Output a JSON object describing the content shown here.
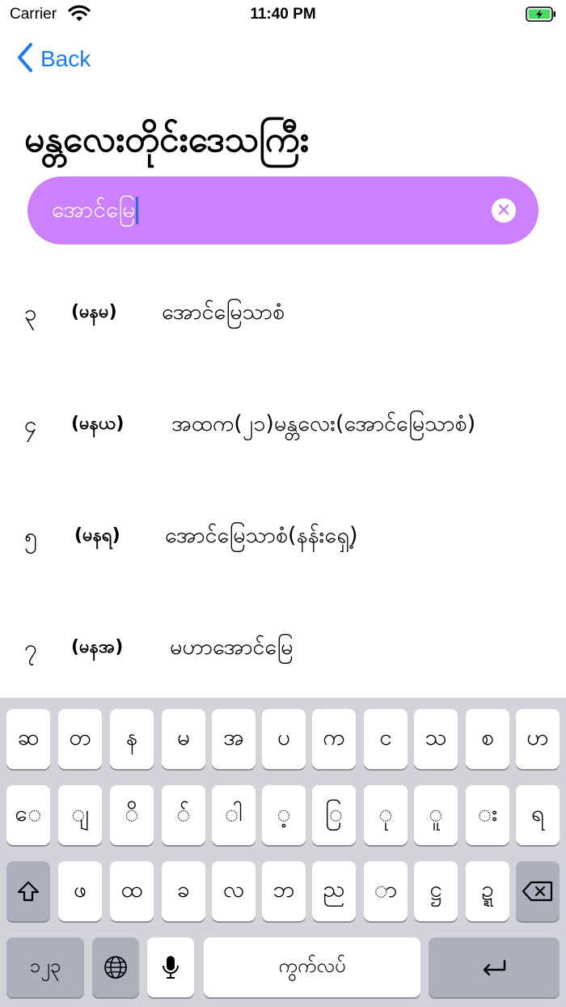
{
  "status_bar": {
    "carrier": "Carrier",
    "time": "11:40 PM",
    "wifi_icon": "wifi-icon",
    "battery_icon": "battery-charging-icon"
  },
  "nav": {
    "back_label": "Back",
    "back_icon": "chevron-left-icon",
    "accent": "#1a7cf7"
  },
  "page": {
    "title": "မန္တလေးတိုင်းဒေသကြီး"
  },
  "search": {
    "value": "အောင်မြေ",
    "clear_icon": "clear-icon",
    "background": "#cc80fb"
  },
  "results": [
    {
      "number": "၃",
      "code": "(မနမ)",
      "name": "အောင်မြေသာစံ"
    },
    {
      "number": "၄",
      "code": "(မနယ)",
      "name": "အထက(၂၁)မန္တလေး(အောင်မြေသာစံ)"
    },
    {
      "number": "၅",
      "code": "(မနရ)",
      "name": "အောင်မြေသာစံ(နန်းရှေ့)"
    },
    {
      "number": "၇",
      "code": "(မနအ)",
      "name": "မဟာအောင်မြေ"
    }
  ],
  "keyboard": {
    "row1": [
      "ဆ",
      "တ",
      "န",
      "မ",
      "အ",
      "ပ",
      "က",
      "င",
      "သ",
      "စ",
      "ဟ"
    ],
    "row2": [
      "◌ေ",
      "◌ျ",
      "◌ိ",
      "◌်",
      "◌ါ",
      "◌့",
      "◌ြ",
      "◌ု",
      "◌ူ",
      "◌း",
      "ရ"
    ],
    "row3": [
      "ဖ",
      "ထ",
      "ခ",
      "လ",
      "ဘ",
      "ည",
      "◌ာ",
      "ဋ္ဌ",
      "ဍ္ဍ"
    ],
    "shift_icon": "shift-icon",
    "delete_icon": "delete-icon",
    "numbers_label": "၁၂၃",
    "globe_icon": "globe-icon",
    "mic_icon": "microphone-icon",
    "space_label": "ကွက်လပ်",
    "return_icon": "return-icon"
  }
}
